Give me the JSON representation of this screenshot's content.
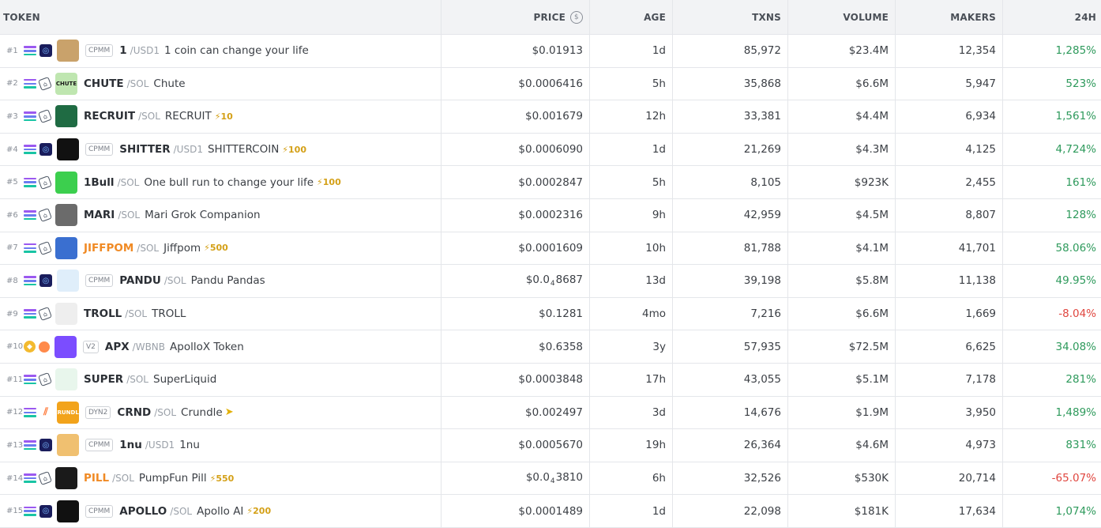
{
  "header": {
    "token": "TOKEN",
    "price": "PRICE",
    "age": "AGE",
    "txns": "TXNS",
    "volume": "VOLUME",
    "makers": "MAKERS",
    "change24h": "24H",
    "currency_icon": "$"
  },
  "rows": [
    {
      "rank": "#1",
      "chain": "solana",
      "dex": "raydium",
      "badge": "CPMM",
      "symbol": "1",
      "quote": "/USD1",
      "name": "1 coin can change your life",
      "boost": "",
      "price": "$0.01913",
      "age": "1d",
      "txns": "85,972",
      "volume": "$23.4M",
      "makers": "12,354",
      "change": "1,285%",
      "trend": "up",
      "logo_color": "#c9a26b",
      "logo_text": ""
    },
    {
      "rank": "#2",
      "chain": "solana",
      "dex": "pumpswap",
      "badge": "",
      "symbol": "CHUTE",
      "quote": "/SOL",
      "name": "Chute",
      "boost": "",
      "price": "$0.0006416",
      "age": "5h",
      "txns": "35,868",
      "volume": "$6.6M",
      "makers": "5,947",
      "change": "523%",
      "trend": "up",
      "logo_color": "#bfe6b0",
      "logo_text": "CHUTE"
    },
    {
      "rank": "#3",
      "chain": "solana",
      "dex": "pumpswap",
      "badge": "",
      "symbol": "RECRUIT",
      "quote": "/SOL",
      "name": "RECRUIT",
      "boost": "10",
      "price": "$0.001679",
      "age": "12h",
      "txns": "33,381",
      "volume": "$4.4M",
      "makers": "6,934",
      "change": "1,561%",
      "trend": "up",
      "logo_color": "#1f6b43",
      "logo_text": ""
    },
    {
      "rank": "#4",
      "chain": "solana",
      "dex": "raydium",
      "badge": "CPMM",
      "symbol": "SHITTER",
      "quote": "/USD1",
      "name": "SHITTERCOIN",
      "boost": "100",
      "price": "$0.0006090",
      "age": "1d",
      "txns": "21,269",
      "volume": "$4.3M",
      "makers": "4,125",
      "change": "4,724%",
      "trend": "up",
      "logo_color": "#111111",
      "logo_text": ""
    },
    {
      "rank": "#5",
      "chain": "solana",
      "dex": "pumpswap",
      "badge": "",
      "symbol": "1Bull",
      "quote": "/SOL",
      "name": "One bull run to change your life",
      "boost": "100",
      "price": "$0.0002847",
      "age": "5h",
      "txns": "8,105",
      "volume": "$923K",
      "makers": "2,455",
      "change": "161%",
      "trend": "up",
      "logo_color": "#3ccf4e",
      "logo_text": ""
    },
    {
      "rank": "#6",
      "chain": "solana",
      "dex": "pumpswap",
      "badge": "",
      "symbol": "MARI",
      "quote": "/SOL",
      "name": "Mari Grok Companion",
      "boost": "",
      "price": "$0.0002316",
      "age": "9h",
      "txns": "42,959",
      "volume": "$4.5M",
      "makers": "8,807",
      "change": "128%",
      "trend": "up",
      "logo_color": "#6b6b6b",
      "logo_text": ""
    },
    {
      "rank": "#7",
      "chain": "solana",
      "dex": "pumpswap",
      "badge": "",
      "symbol": "JIFFPOM",
      "quote": "/SOL",
      "name": "Jiffpom",
      "boost": "500",
      "price": "$0.0001609",
      "age": "10h",
      "txns": "81,788",
      "volume": "$4.1M",
      "makers": "41,701",
      "change": "58.06%",
      "trend": "up",
      "logo_color": "#3a6fd0",
      "logo_text": "",
      "symbol_orange": true
    },
    {
      "rank": "#8",
      "chain": "solana",
      "dex": "raydium",
      "badge": "CPMM",
      "symbol": "PANDU",
      "quote": "/SOL",
      "name": "Pandu Pandas",
      "boost": "",
      "price_parts": [
        "$0.0",
        "4",
        "8687"
      ],
      "age": "13d",
      "txns": "39,198",
      "volume": "$5.8M",
      "makers": "11,138",
      "change": "49.95%",
      "trend": "up",
      "logo_color": "#dfeefa",
      "logo_text": ""
    },
    {
      "rank": "#9",
      "chain": "solana",
      "dex": "pumpswap",
      "badge": "",
      "symbol": "TROLL",
      "quote": "/SOL",
      "name": "TROLL",
      "boost": "",
      "price": "$0.1281",
      "age": "4mo",
      "txns": "7,216",
      "volume": "$6.6M",
      "makers": "1,669",
      "change": "-8.04%",
      "trend": "down",
      "logo_color": "#eeeeee",
      "logo_text": ""
    },
    {
      "rank": "#10",
      "chain": "bsc",
      "dex": "pancake",
      "badge": "V2",
      "symbol": "APX",
      "quote": "/WBNB",
      "name": "ApolloX Token",
      "boost": "",
      "price": "$0.6358",
      "age": "3y",
      "txns": "57,935",
      "volume": "$72.5M",
      "makers": "6,625",
      "change": "34.08%",
      "trend": "up",
      "logo_color": "#7b4dff",
      "logo_text": ""
    },
    {
      "rank": "#11",
      "chain": "solana",
      "dex": "pumpswap",
      "badge": "",
      "symbol": "SUPER",
      "quote": "/SOL",
      "name": "SuperLiquid",
      "boost": "",
      "price": "$0.0003848",
      "age": "17h",
      "txns": "43,055",
      "volume": "$5.1M",
      "makers": "7,178",
      "change": "281%",
      "trend": "up",
      "logo_color": "#e8f6ec",
      "logo_text": ""
    },
    {
      "rank": "#12",
      "chain": "solana",
      "dex": "meteora",
      "badge": "DYN2",
      "symbol": "CRND",
      "quote": "/SOL",
      "name": "Crundle",
      "boost": "bolt",
      "price": "$0.002497",
      "age": "3d",
      "txns": "14,676",
      "volume": "$1.9M",
      "makers": "3,950",
      "change": "1,489%",
      "trend": "up",
      "logo_color": "#f2a31b",
      "logo_text": "CRUNDLE"
    },
    {
      "rank": "#13",
      "chain": "solana",
      "dex": "raydium",
      "badge": "CPMM",
      "symbol": "1nu",
      "quote": "/USD1",
      "name": "1nu",
      "boost": "",
      "price": "$0.0005670",
      "age": "19h",
      "txns": "26,364",
      "volume": "$4.6M",
      "makers": "4,973",
      "change": "831%",
      "trend": "up",
      "logo_color": "#f0c070",
      "logo_text": ""
    },
    {
      "rank": "#14",
      "chain": "solana",
      "dex": "pumpswap",
      "badge": "",
      "symbol": "PILL",
      "quote": "/SOL",
      "name": "PumpFun Pill",
      "boost": "550",
      "price_parts": [
        "$0.0",
        "4",
        "3810"
      ],
      "age": "6h",
      "txns": "32,526",
      "volume": "$530K",
      "makers": "20,714",
      "change": "-65.07%",
      "trend": "down",
      "logo_color": "#1a1a1a",
      "logo_text": "",
      "symbol_orange": true
    },
    {
      "rank": "#15",
      "chain": "solana",
      "dex": "raydium",
      "badge": "CPMM",
      "symbol": "APOLLO",
      "quote": "/SOL",
      "name": "Apollo AI",
      "boost": "200",
      "price": "$0.0001489",
      "age": "1d",
      "txns": "22,098",
      "volume": "$181K",
      "makers": "17,634",
      "change": "1,074%",
      "trend": "up",
      "logo_color": "#111111",
      "logo_text": ""
    }
  ]
}
